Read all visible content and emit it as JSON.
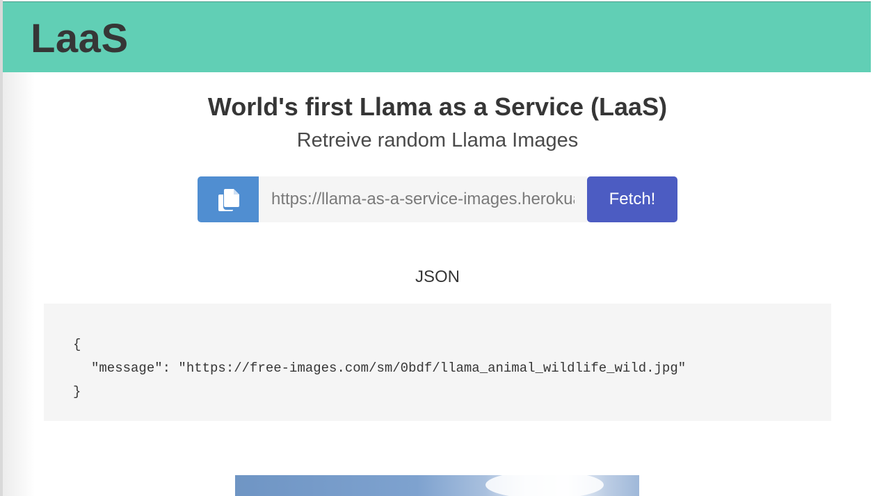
{
  "navbar": {
    "brand": "LaaS",
    "color": "#61cfb5"
  },
  "hero": {
    "title": "World's first Llama as a Service (LaaS)",
    "subtitle": "Retreive random Llama Images"
  },
  "fetch_form": {
    "copy_icon": "copy-icon",
    "url_value": "https://llama-as-a-service-images.herokuapp.com/random",
    "fetch_label": "Fetch!",
    "copy_button_color": "#508ed1",
    "fetch_button_color": "#4c5cc2"
  },
  "json_section": {
    "heading": "JSON",
    "lines": [
      "{",
      "\"message\": \"https://free-images.com/sm/0bdf/llama_animal_wildlife_wild.jpg\"",
      "}"
    ]
  },
  "image": {
    "subject": "llama photo (sky with clouds, partially visible)"
  }
}
